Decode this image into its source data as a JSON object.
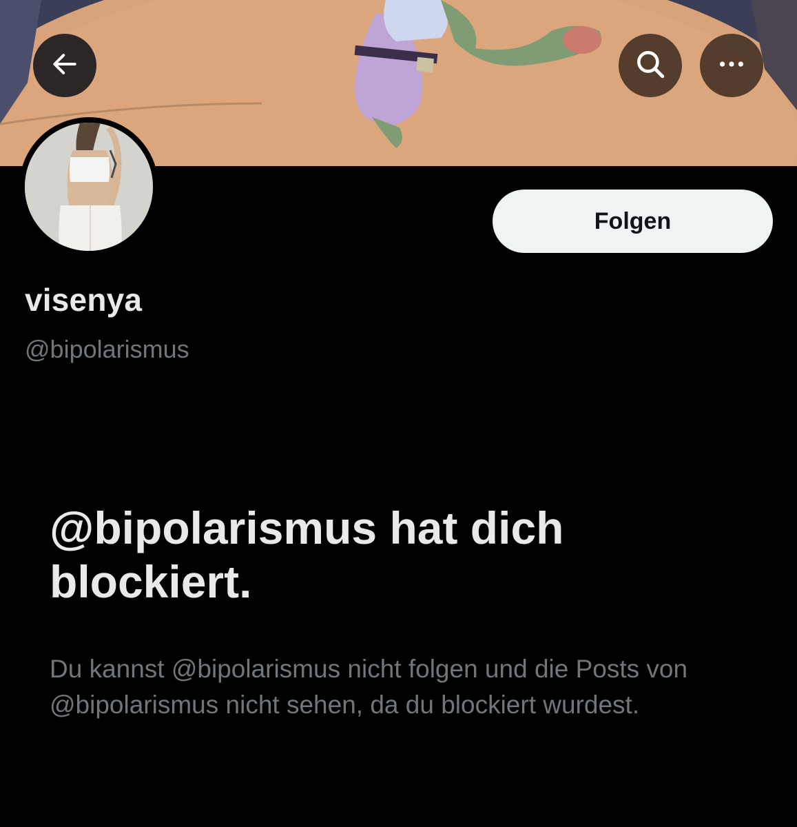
{
  "header": {
    "back_icon": "arrow-left-icon",
    "search_icon": "search-icon",
    "more_icon": "more-horizontal-icon"
  },
  "profile": {
    "display_name": "visenya",
    "handle": "@bipolarismus",
    "follow_label": "Folgen"
  },
  "blocked": {
    "title": "@bipolarismus hat dich blockiert.",
    "description": "Du kannst @bipolarismus nicht folgen und die Posts von @bipolarismus nicht sehen, da du blockiert wurdest."
  },
  "colors": {
    "background": "#000000",
    "primary_text": "#e7e9ea",
    "secondary_text": "#71767b",
    "follow_button_bg": "#eff3f4",
    "follow_button_text": "#0f1419"
  }
}
